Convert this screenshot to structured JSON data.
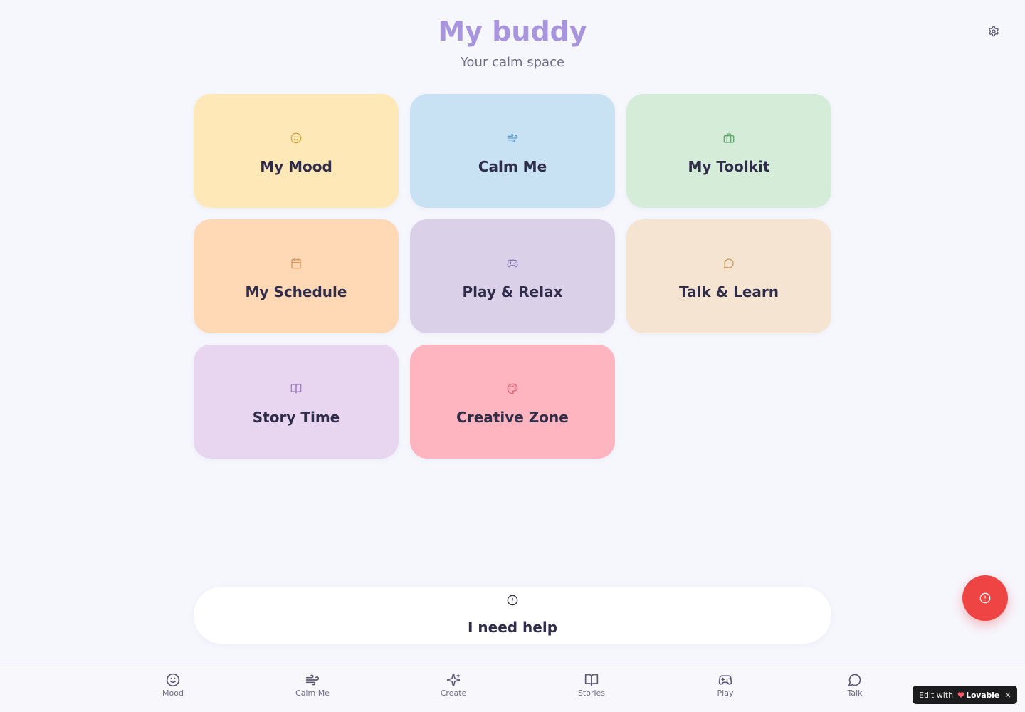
{
  "header": {
    "title": "My buddy",
    "subtitle": "Your calm space",
    "settings_icon": "gear-icon"
  },
  "cards": [
    {
      "label": "My Mood",
      "icon": "smile-icon",
      "bg": "#ffe8b8",
      "icon_color": "#d4a43c"
    },
    {
      "label": "Calm Me",
      "icon": "wind-icon",
      "bg": "#c8e1f3",
      "icon_color": "#5b9fd0"
    },
    {
      "label": "My Toolkit",
      "icon": "briefcase-icon",
      "bg": "#d5ecd9",
      "icon_color": "#5fa86d"
    },
    {
      "label": "My Schedule",
      "icon": "calendar-icon",
      "bg": "#ffd8b6",
      "icon_color": "#dc9357"
    },
    {
      "label": "Play & Relax",
      "icon": "gamepad-icon",
      "bg": "#dad1e8",
      "icon_color": "#8c78b8"
    },
    {
      "label": "Talk & Learn",
      "icon": "chat-icon",
      "bg": "#f5e4d1",
      "icon_color": "#cc9a5c"
    },
    {
      "label": "Story Time",
      "icon": "book-icon",
      "bg": "#e8d6f1",
      "icon_color": "#a07ec2"
    },
    {
      "label": "Creative Zone",
      "icon": "palette-icon",
      "bg": "#ffb5bf",
      "icon_color": "#e0606f"
    }
  ],
  "help": {
    "label": "I need help",
    "icon": "alert-circle-icon"
  },
  "fab": {
    "icon": "alert-circle-icon",
    "color": "#ef4444"
  },
  "nav": [
    {
      "label": "Mood",
      "icon": "smile-icon"
    },
    {
      "label": "Calm Me",
      "icon": "wind-icon"
    },
    {
      "label": "Create",
      "icon": "sparkles-icon"
    },
    {
      "label": "Stories",
      "icon": "book-icon"
    },
    {
      "label": "Play",
      "icon": "gamepad-icon"
    },
    {
      "label": "Talk",
      "icon": "chat-icon"
    }
  ],
  "badge": {
    "edit_text": "Edit with",
    "brand": "Lovable",
    "close": "×"
  },
  "colors": {
    "accent": "#a895dd",
    "text_dark": "#2f2d4a",
    "background": "#f6f7fd"
  }
}
